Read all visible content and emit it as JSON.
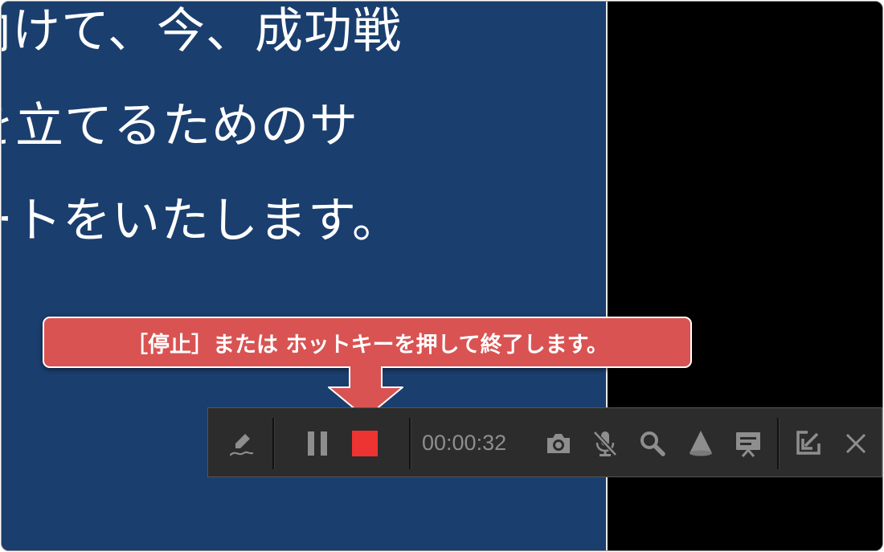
{
  "slide": {
    "lines": [
      "向けて、今、成功戦",
      "を立てるためのサ",
      "ートをいたします。"
    ]
  },
  "callout": {
    "text": "［停止］または ホットキーを押して終了します。"
  },
  "toolbar": {
    "timer": "00:00:32",
    "stop_color": "#ee3333",
    "icon_color": "#8e8e8e",
    "icons": [
      "pen-icon",
      "pause-icon",
      "stop-icon",
      "camera-icon",
      "mic-muted-icon",
      "zoom-icon",
      "spotlight-icon",
      "whiteboard-icon",
      "minimize-icon",
      "close-icon"
    ]
  },
  "colors": {
    "slide_bg": "#1a3e6e",
    "callout_bg": "#d95353",
    "toolbar_bg": "#2c2c2c"
  }
}
